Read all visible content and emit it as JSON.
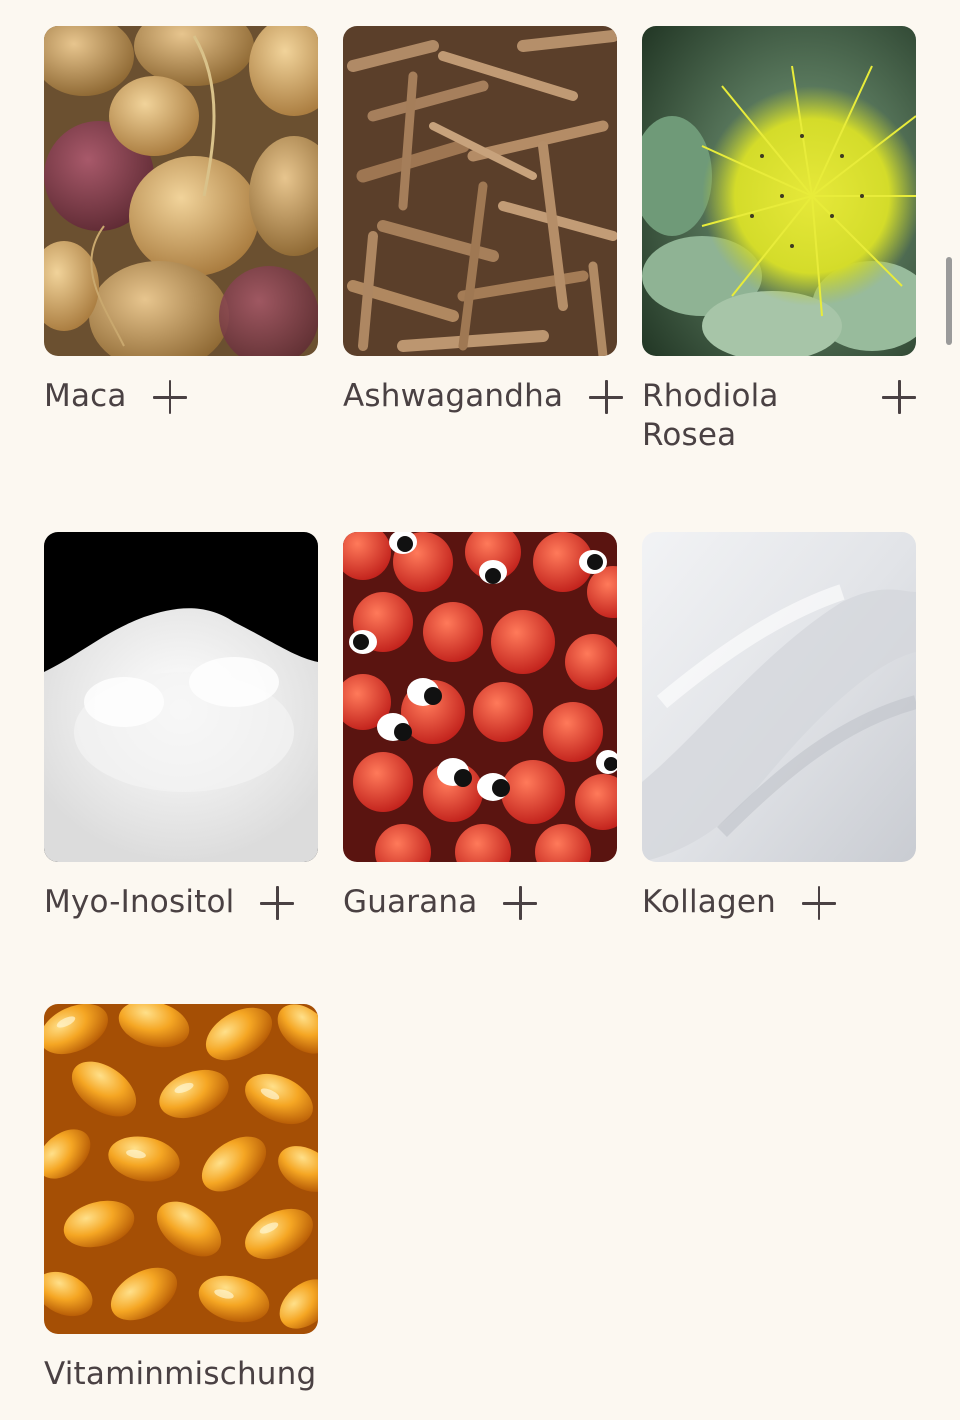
{
  "ingredients": [
    {
      "label": "Maca",
      "image": "maca-roots"
    },
    {
      "label": "Ashwagandha",
      "image": "ashwagandha-roots"
    },
    {
      "label": "Rhodiola Rosea",
      "image": "rhodiola-flower"
    },
    {
      "label": "Myo-Inositol",
      "image": "white-powder-pile"
    },
    {
      "label": "Guarana",
      "image": "guarana-berries"
    },
    {
      "label": "Kollagen",
      "image": "collagen-powder"
    },
    {
      "label": "Vitaminmischung",
      "image": "softgel-capsules"
    }
  ],
  "icons": {
    "add": "plus-icon"
  },
  "colors": {
    "background": "#fcf8f1",
    "text": "#4a4143"
  }
}
